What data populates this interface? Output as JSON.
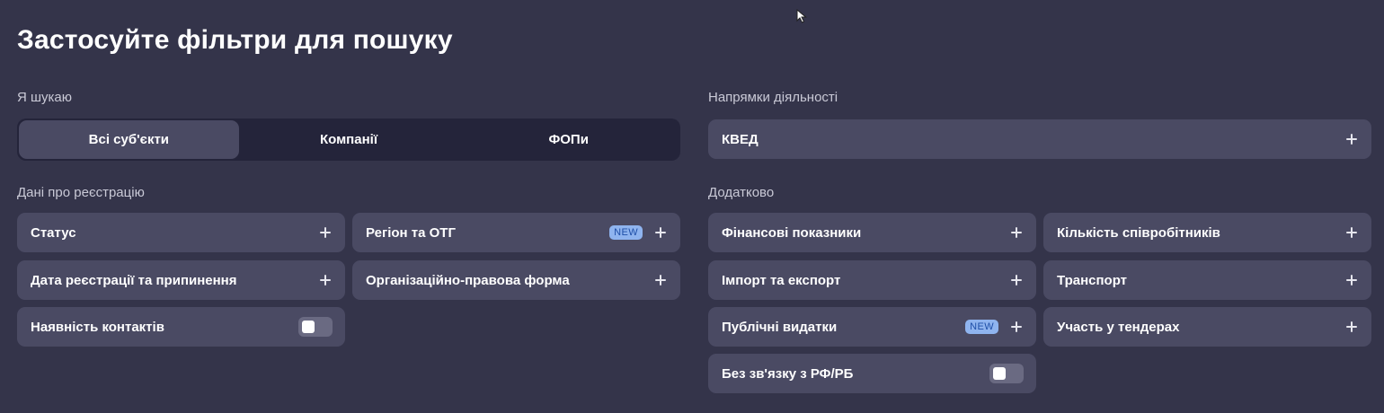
{
  "title": "Застосуйте фільтри для пошуку",
  "search_for": {
    "label": "Я шукаю",
    "options": [
      "Всі суб'єкти",
      "Компанії",
      "ФОПи"
    ],
    "selected": "Всі суб'єкти"
  },
  "activities": {
    "label": "Напрямки діяльності",
    "kved": "КВЕД"
  },
  "registration": {
    "label": "Дані про реєстрацію",
    "status": "Статус",
    "region": "Регіон та ОТГ",
    "region_badge": "NEW",
    "dates": "Дата реєстрації та припинення",
    "legal_form": "Організаційно-правова форма",
    "contacts": "Наявність контактів",
    "contacts_enabled": false
  },
  "additional": {
    "label": "Додатково",
    "finance": "Фінансові показники",
    "employees": "Кількість співробітників",
    "import_export": "Імпорт та експорт",
    "transport": "Транспорт",
    "public_spending": "Публічні видатки",
    "public_spending_badge": "NEW",
    "tenders": "Участь у тендерах",
    "no_ru_by": "Без зв'язку з РФ/РБ",
    "no_ru_by_enabled": false
  },
  "icons": {
    "add": "plus-icon",
    "cursor": "mouse-pointer-icon"
  },
  "colors": {
    "background": "#34344a",
    "card": "#4a4a63",
    "segment_bg": "#24243a",
    "badge_bg": "#8fb4ef",
    "badge_text": "#1f4fa8"
  }
}
